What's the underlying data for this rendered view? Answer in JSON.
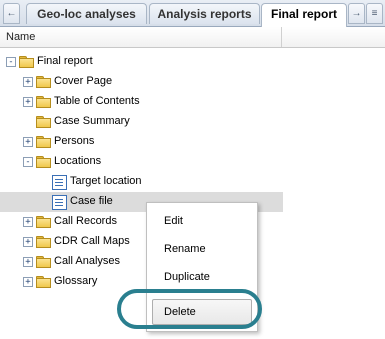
{
  "tabs": [
    {
      "label": "Geo-loc analyses"
    },
    {
      "label": "Analysis reports"
    },
    {
      "label": "Final report"
    }
  ],
  "nav": {
    "left_icon": "arrow-left-icon",
    "right_icon": "arrow-right-icon",
    "menu_icon": "chevron-down-icon"
  },
  "column": {
    "name": "Name"
  },
  "tree": [
    {
      "label": "Final report",
      "expander": "-",
      "icon": "folder"
    },
    {
      "label": "Cover Page",
      "expander": "+",
      "icon": "folder"
    },
    {
      "label": "Table of Contents",
      "expander": "+",
      "icon": "folder"
    },
    {
      "label": "Case Summary",
      "expander": "",
      "icon": "folder"
    },
    {
      "label": "Persons",
      "expander": "+",
      "icon": "folder"
    },
    {
      "label": "Locations",
      "expander": "-",
      "icon": "folder"
    },
    {
      "label": "Target location",
      "expander": "",
      "icon": "document"
    },
    {
      "label": "Case file",
      "expander": "",
      "icon": "document"
    },
    {
      "label": "Call Records",
      "expander": "+",
      "icon": "folder"
    },
    {
      "label": "CDR Call Maps",
      "expander": "+",
      "icon": "folder"
    },
    {
      "label": "Call Analyses",
      "expander": "+",
      "icon": "folder"
    },
    {
      "label": "Glossary",
      "expander": "+",
      "icon": "folder"
    }
  ],
  "context_menu": {
    "edit": "Edit",
    "rename": "Rename",
    "duplicate": "Duplicate",
    "delete": "Delete"
  },
  "colors": {
    "highlight_ring": "#2a7f8f",
    "folder": "#f0c84d",
    "selection": "#dcdcdc"
  }
}
